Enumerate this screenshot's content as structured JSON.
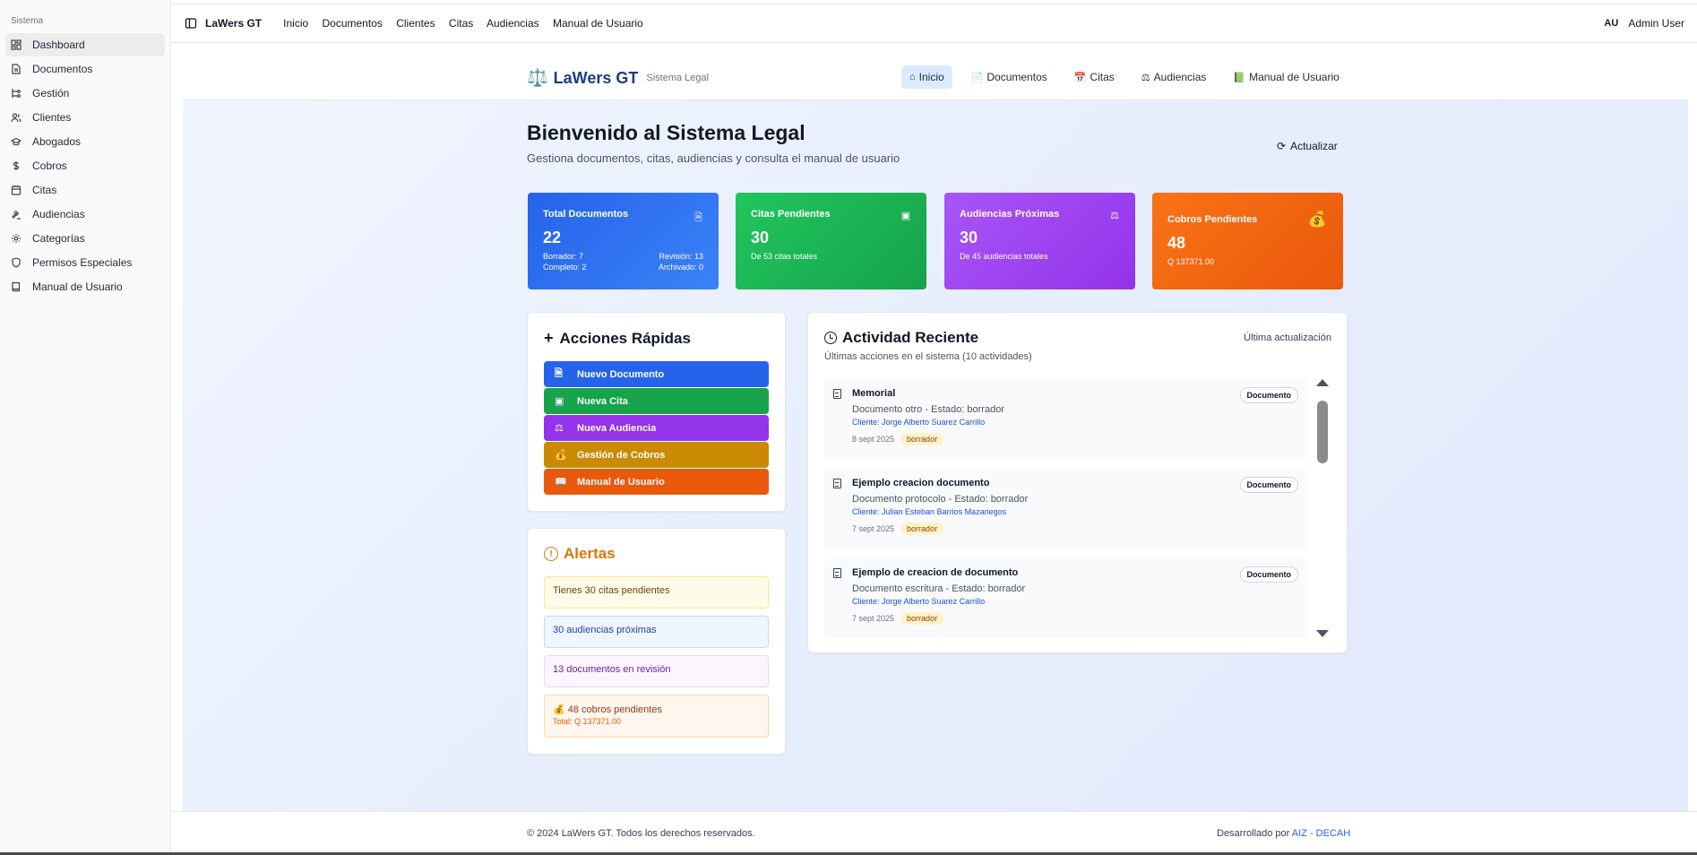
{
  "sidebar": {
    "group_label": "Sistema",
    "items": [
      {
        "label": "Dashboard",
        "icon": "dashboard-icon",
        "active": true
      },
      {
        "label": "Documentos",
        "icon": "file-icon"
      },
      {
        "label": "Gestión",
        "icon": "workflow-icon"
      },
      {
        "label": "Clientes",
        "icon": "users-icon"
      },
      {
        "label": "Abogados",
        "icon": "graduation-cap-icon"
      },
      {
        "label": "Cobros",
        "icon": "dollar-icon"
      },
      {
        "label": "Citas",
        "icon": "calendar-icon"
      },
      {
        "label": "Audiencias",
        "icon": "gavel-icon"
      },
      {
        "label": "Categorías",
        "icon": "gear-icon"
      },
      {
        "label": "Permisos Especiales",
        "icon": "shield-icon"
      },
      {
        "label": "Manual de Usuario",
        "icon": "book-icon"
      }
    ]
  },
  "topbar": {
    "app_title": "LaWers GT",
    "nav": [
      "Inicio",
      "Documentos",
      "Clientes",
      "Citas",
      "Audiencias",
      "Manual de Usuario"
    ],
    "user_initials": "AU",
    "user_name": "Admin User"
  },
  "header": {
    "brand_name": "LaWers GT",
    "brand_sub": "Sistema Legal",
    "nav": [
      {
        "label": "Inicio",
        "icon": "home-icon",
        "active": true
      },
      {
        "label": "Documentos",
        "icon": "file-icon"
      },
      {
        "label": "Citas",
        "icon": "calendar-icon"
      },
      {
        "label": "Audiencias",
        "icon": "scales-icon"
      },
      {
        "label": "Manual de Usuario",
        "icon": "book-icon"
      }
    ]
  },
  "welcome": {
    "title": "Bienvenido al Sistema Legal",
    "subtitle": "Gestiona documentos, citas, audiencias y consulta el manual de usuario",
    "refresh_label": "Actualizar"
  },
  "stats": {
    "documentos": {
      "label": "Total Documentos",
      "value": "22",
      "borrador": "Borrador: 7",
      "revision": "Revisión: 13",
      "completo": "Completo: 2",
      "archivado": "Archivado: 0",
      "color": "#2563eb"
    },
    "citas": {
      "label": "Citas Pendientes",
      "value": "30",
      "detail": "De 53 citas totales",
      "color": "#16a34a"
    },
    "audiencias": {
      "label": "Audiencias Próximas",
      "value": "30",
      "detail": "De 45 audiencias totales",
      "color": "#9333ea"
    },
    "cobros": {
      "label": "Cobros Pendientes",
      "value": "48",
      "detail": "Q 137371.00",
      "color": "#ea580c"
    }
  },
  "quick_actions": {
    "title": "Acciones Rápidas",
    "buttons": [
      {
        "label": "Nuevo Documento",
        "icon": "file-icon",
        "color": "#2563eb"
      },
      {
        "label": "Nueva Cita",
        "icon": "calendar-icon",
        "color": "#16a34a"
      },
      {
        "label": "Nueva Audiencia",
        "icon": "scales-icon",
        "color": "#9333ea"
      },
      {
        "label": "Gestión de Cobros",
        "icon": "money-bag-icon",
        "color": "#ca8a04"
      },
      {
        "label": "Manual de Usuario",
        "icon": "book-icon",
        "color": "#ea580c"
      }
    ]
  },
  "alerts": {
    "title": "Alertas",
    "items": [
      "Tienes 30 citas pendientes",
      "30 audiencias próximas",
      "13 documentos en revisión",
      "48 cobros pendientes"
    ],
    "cobros_total": "Total: Q 137371.00"
  },
  "activity": {
    "title": "Actividad Reciente",
    "subtitle": "Últimas acciones en el sistema (10 actividades)",
    "last_update": "Última actualización",
    "items": [
      {
        "title": "Memorial",
        "desc": "Documento otro - Estado: borrador",
        "client": "Cliente: Jorge Alberto Suarez Carrillo",
        "date": "8 sept 2025",
        "status": "borrador",
        "type": "Documento"
      },
      {
        "title": "Ejemplo creacion documento",
        "desc": "Documento protocolo - Estado: borrador",
        "client": "Cliente: Julian Esteban Barrios Mazariegos",
        "date": "7 sept 2025",
        "status": "borrador",
        "type": "Documento"
      },
      {
        "title": "Ejemplo de creacion de documento",
        "desc": "Documento escritura - Estado: borrador",
        "client": "Cliente: Jorge Alberto Suarez Carrillo",
        "date": "7 sept 2025",
        "status": "borrador",
        "type": "Documento"
      }
    ]
  },
  "footer": {
    "copyright": "© 2024 LaWers GT. Todos los derechos reservados.",
    "dev_prefix": "Desarrollado por ",
    "dev_link": "AIZ - DECAH"
  }
}
